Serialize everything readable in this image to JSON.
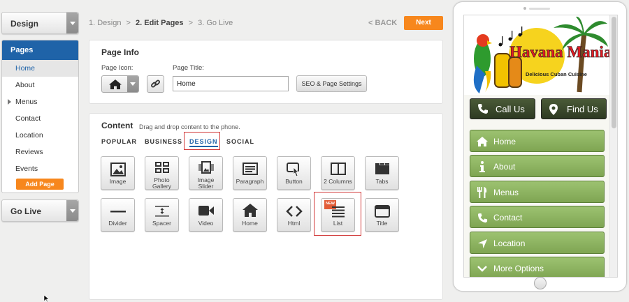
{
  "left": {
    "design_dropdown": "Design",
    "pages_header": "Pages",
    "pages": [
      {
        "label": "Home",
        "active": true,
        "has_children": false
      },
      {
        "label": "About",
        "active": false,
        "has_children": false
      },
      {
        "label": "Menus",
        "active": false,
        "has_children": true
      },
      {
        "label": "Contact",
        "active": false,
        "has_children": false
      },
      {
        "label": "Location",
        "active": false,
        "has_children": false
      },
      {
        "label": "Reviews",
        "active": false,
        "has_children": false
      },
      {
        "label": "Events",
        "active": false,
        "has_children": false
      }
    ],
    "add_page": "Add Page",
    "golive_dropdown": "Go Live"
  },
  "topbar": {
    "steps": [
      "1. Design",
      "2. Edit Pages",
      "3. Go Live"
    ],
    "current_step": 1,
    "separator": ">",
    "back": "< BACK",
    "next": "Next"
  },
  "page_info": {
    "title": "Page Info",
    "icon_label": "Page Icon:",
    "title_label": "Page Title:",
    "title_value": "Home",
    "seo_button": "SEO & Page Settings"
  },
  "content": {
    "title": "Content",
    "hint": "Drag and drop content to the phone.",
    "tabs": [
      "POPULAR",
      "BUSINESS",
      "DESIGN",
      "SOCIAL"
    ],
    "active_tab": "DESIGN",
    "tiles_row1": [
      {
        "label": "Image",
        "icon": "image-icon"
      },
      {
        "label": "Photo Gallery",
        "icon": "gallery-icon"
      },
      {
        "label": "Image Slider",
        "icon": "slider-icon"
      },
      {
        "label": "Paragraph",
        "icon": "paragraph-icon"
      },
      {
        "label": "Button",
        "icon": "button-icon"
      },
      {
        "label": "2 Columns",
        "icon": "columns-icon"
      },
      {
        "label": "Tabs",
        "icon": "tabs-icon"
      }
    ],
    "tiles_row2": [
      {
        "label": "Divider",
        "icon": "divider-icon"
      },
      {
        "label": "Spacer",
        "icon": "spacer-icon"
      },
      {
        "label": "Video",
        "icon": "video-icon"
      },
      {
        "label": "Home",
        "icon": "home-icon"
      },
      {
        "label": "Html",
        "icon": "code-icon"
      },
      {
        "label": "List",
        "icon": "list-icon",
        "badge": "NEW"
      },
      {
        "label": "Title",
        "icon": "title-icon"
      }
    ]
  },
  "phone": {
    "logo_title": "Havana Mania",
    "logo_subtitle": "Delicious Cuban Cuisine",
    "call_button": "Call Us",
    "find_button": "Find Us",
    "nav": [
      {
        "label": "Home",
        "icon": "home-icon"
      },
      {
        "label": "About",
        "icon": "info-icon"
      },
      {
        "label": "Menus",
        "icon": "utensils-icon"
      },
      {
        "label": "Contact",
        "icon": "phone-icon"
      },
      {
        "label": "Location",
        "icon": "location-arrow-icon"
      },
      {
        "label": "More Options",
        "icon": "chevron-down-icon"
      }
    ]
  },
  "colors": {
    "accent_orange": "#f7871d",
    "nav_blue": "#1f63a8",
    "phone_green": "#8db662",
    "highlight_red": "#d23a3a"
  }
}
